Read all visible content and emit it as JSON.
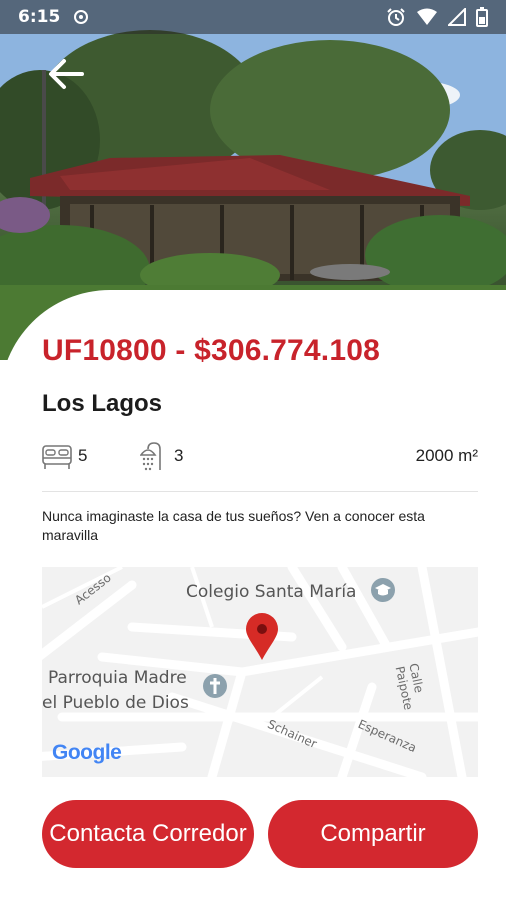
{
  "status_bar": {
    "time": "6:15"
  },
  "listing": {
    "price": "UF10800 - $306.774.108",
    "title": "Los Lagos",
    "bedrooms": "5",
    "bathrooms": "3",
    "area": "2000 m²",
    "description": "Nunca imaginaste la casa de tus sueños? Ven a conocer esta maravilla"
  },
  "map": {
    "poi_school": "Colegio Santa María",
    "poi_church_line1": "Parroquia Madre",
    "poi_church_line2": "el Pueblo de Dios",
    "street_acesso": "Acesso",
    "street_papote": "Calle Paipote",
    "street_schainer": "Schainer",
    "street_esperanza": "Esperanza",
    "logo": "Google"
  },
  "actions": {
    "contact_label": "Contacta Corredor",
    "share_label": "Compartir"
  },
  "colors": {
    "accent": "#d3282f",
    "price": "#c8232b"
  }
}
